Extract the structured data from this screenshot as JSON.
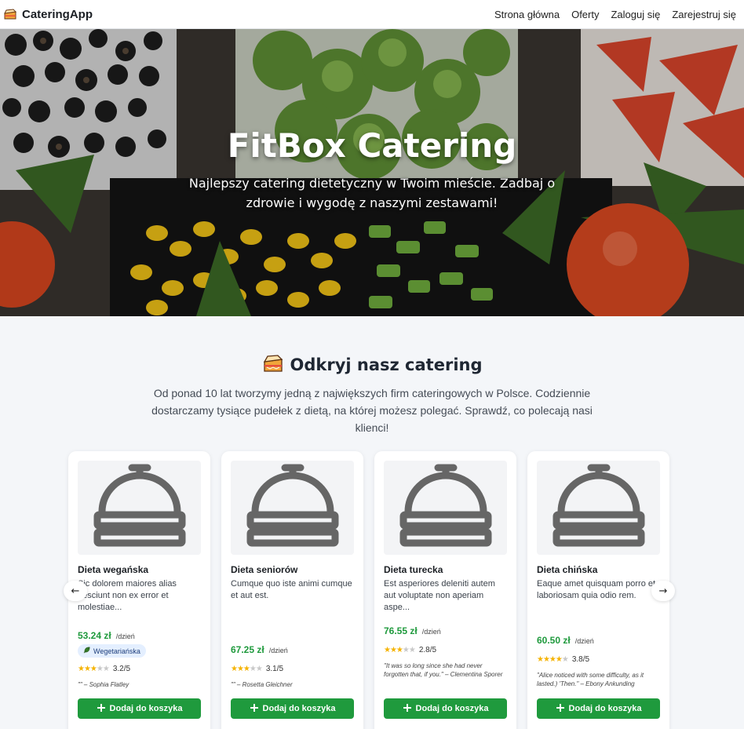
{
  "navbar": {
    "brand": "CateringApp",
    "links": [
      "Strona główna",
      "Oferty",
      "Zaloguj się",
      "Zarejestruj się"
    ]
  },
  "hero": {
    "title": "FitBox Catering",
    "subtitle": "Najlepszy catering dietetyczny w Twoim mieście. Zadbaj o zdrowie i wygodę z naszymi zestawami!"
  },
  "section": {
    "title": "Odkryj nasz catering",
    "description": "Od ponad 10 lat tworzymy jedną z największych firm cateringowych w Polsce. Codziennie dostarczamy tysiące pudełek z dietą, na której możesz polegać. Sprawdź, co polecają nasi klienci!"
  },
  "cards": [
    {
      "title": "Dieta wegańska",
      "description": "Sic dolorem maiores alias nesciunt non ex error et molestiae...",
      "price": "53.24 zł",
      "per": "/dzień",
      "badge": "Wegetariańska",
      "rating_value": 3.2,
      "rating": "3.2/5",
      "review": "\"\" – Sophia Flatley"
    },
    {
      "title": "Dieta seniorów",
      "description": "Cumque quo iste animi cumque et aut est.",
      "price": "67.25 zł",
      "per": "/dzień",
      "rating_value": 3.1,
      "rating": "3.1/5",
      "review": "\"\" – Rosetta Gleichner"
    },
    {
      "title": "Dieta turecka",
      "description": "Est asperiores deleniti autem aut voluptate non aperiam aspe...",
      "price": "76.55 zł",
      "per": "/dzień",
      "rating_value": 2.8,
      "rating": "2.8/5",
      "review": "\"It was so long since she had never forgotten that, if you.\" – Clementina Sporer"
    },
    {
      "title": "Dieta chińska",
      "description": "Eaque amet quisquam porro et laboriosam quia odio rem.",
      "price": "60.50 zł",
      "per": "/dzień",
      "rating_value": 3.8,
      "rating": "3.8/5",
      "review": "\"Alice noticed with some difficulty, as it lasted.) 'Then.\" – Ebony Ankunding"
    }
  ],
  "add_to_cart_label": "Dodaj do koszyka",
  "carousel": {
    "prev": "←",
    "next": "→"
  },
  "colors": {
    "accent_green": "#1f9a3d",
    "badge_bg": "#e4efff",
    "star": "#f5b301"
  },
  "icons": [
    "cake-icon",
    "cloche-icon",
    "leaf-icon",
    "plus-icon",
    "arrow-left-icon",
    "arrow-right-icon"
  ]
}
